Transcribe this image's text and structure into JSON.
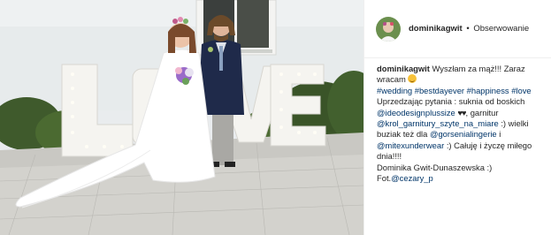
{
  "header": {
    "username": "dominikagwit",
    "separator": "•",
    "follow_label": "Obserwowanie",
    "avatar_icon": "profile-avatar-icon"
  },
  "photo": {
    "description_icon": "post-photo",
    "sign_letters": [
      "L",
      "O",
      "V",
      "E"
    ]
  },
  "caption": {
    "username": "dominikagwit",
    "line1_text": "Wyszłam za mąż!!! Zaraz",
    "line2_text": "wracam",
    "hashtags": [
      "#wedding",
      "#bestdayever",
      "#happiness",
      "#love"
    ],
    "line4_text": "Uprzedzając pytania : suknia od boskich",
    "mention_ideo": "@ideodesignplussize",
    "hearts": "♥♥",
    "line5_suffix": ", garnitur",
    "mention_krol": "@krol_garnitury_szyte_na_miare",
    "line6_suffix": ":) wielki",
    "line7_text": "buziak też dla",
    "mention_gorsenia": "@gorsenialingerie",
    "line7_suffix": "i",
    "mention_mitex": "@mitexunderwear",
    "line8_suffix": ":) Całuję i życzę miłego",
    "line9_text": "dnia!!!!",
    "line10_text": "Dominika Gwit-Dunaszewska :)",
    "photo_credit_label": "Fot.",
    "mention_photographer": "@cezary_p"
  },
  "colors": {
    "link": "#003569",
    "text": "#262626",
    "divider": "#efefef"
  }
}
